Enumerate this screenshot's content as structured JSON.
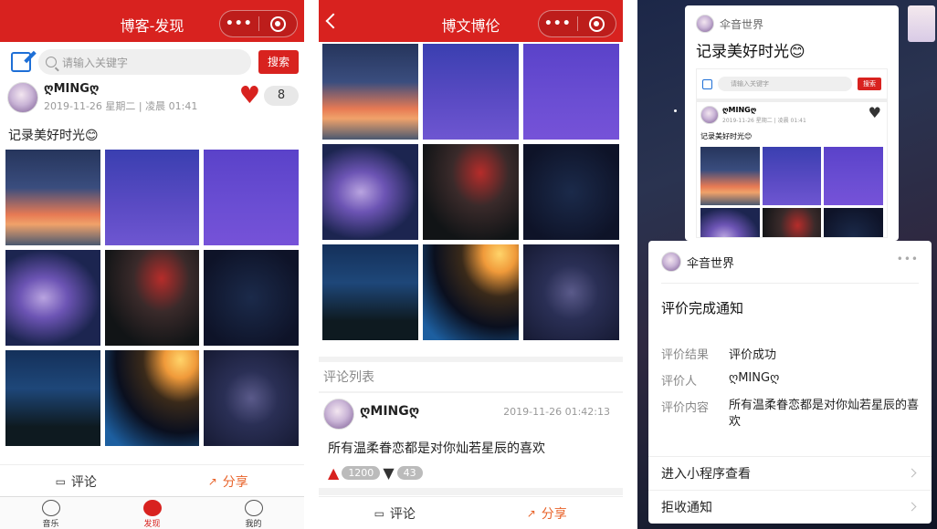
{
  "discover": {
    "title": "博客-发现",
    "capsule_dots": "•••",
    "search_placeholder": "请输入关键字",
    "search_button": "搜索",
    "post": {
      "author": "ღMINGღ",
      "time": "2019-11-26 星期二 | 凌晨 01:41",
      "likes": "8",
      "text": "记录美好时光😊"
    },
    "actions": {
      "comment": "评论",
      "share": "分享"
    },
    "tabs": [
      {
        "label": "音乐"
      },
      {
        "label": "发现"
      },
      {
        "label": "我的"
      }
    ]
  },
  "detail": {
    "title": "博文博伦",
    "comments_title": "评论列表",
    "comment": {
      "author": "ღMINGღ",
      "time": "2019-11-26 01:42:13",
      "text": "所有温柔眷恋都是对你灿若星辰的喜欢",
      "up": "1200",
      "down": "43"
    },
    "actions": {
      "comment": "评论",
      "share": "分享"
    }
  },
  "share_card": {
    "app_name": "伞音世界",
    "title": "记录美好时光😊",
    "search_placeholder": "请输入关键字",
    "search_button": "搜索",
    "author": "ღMINGღ",
    "time": "2019-11-26 星期二 | 凌晨 01:41",
    "text": "记录美好时光😊"
  },
  "notification": {
    "app_name": "伞音世界",
    "more": "•••",
    "title": "评价完成通知",
    "rows": [
      {
        "label": "评价结果",
        "value": "评价成功"
      },
      {
        "label": "评价人",
        "value": "ღMINGღ"
      },
      {
        "label": "评价内容",
        "value": "所有温柔眷恋都是对你灿若星辰的喜欢"
      }
    ],
    "links": [
      {
        "label": "进入小程序查看"
      },
      {
        "label": "拒收通知"
      }
    ]
  },
  "colors": {
    "brand_red": "#d8221f",
    "link_blue": "#1e6fd6"
  }
}
